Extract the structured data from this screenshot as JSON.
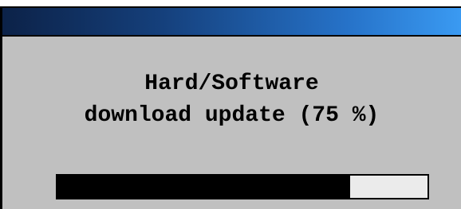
{
  "dialog": {
    "title": "",
    "message_line1": "Hard/Software",
    "message_line2": "download update (75 %)",
    "progress_fraction": 0.79
  },
  "colors": {
    "window_bg": "#c0c0c0",
    "titlebar_start": "#0c2248",
    "titlebar_end": "#3a9af2",
    "progress_fill": "#000000",
    "progress_track": "#ebebeb"
  }
}
